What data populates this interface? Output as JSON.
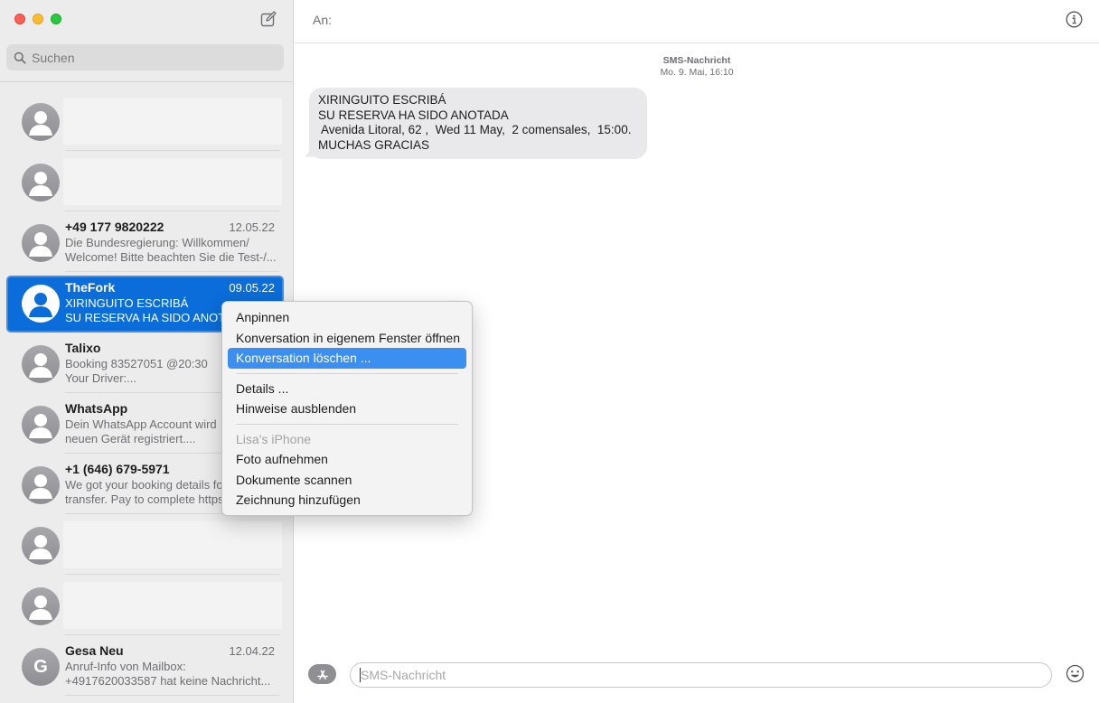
{
  "window": {
    "compose_icon": "compose-icon",
    "search": {
      "placeholder": "Suchen",
      "icon": "search-icon"
    }
  },
  "conversations": [
    {
      "name": "",
      "date": "",
      "preview": [
        "",
        ""
      ],
      "redacted": true
    },
    {
      "name": "",
      "date": "",
      "preview": [
        "",
        ""
      ],
      "redacted": true
    },
    {
      "name": "+49 177 9820222",
      "date": "12.05.22",
      "preview": [
        "Die Bundesregierung: Willkommen/",
        "Welcome! Bitte beachten Sie die Test-/..."
      ]
    },
    {
      "name": "TheFork",
      "date": "09.05.22",
      "preview": [
        "XIRINGUITO ESCRIBÁ",
        "SU RESERVA HA SIDO ANOTADA"
      ],
      "selected": true
    },
    {
      "name": "Talixo",
      "date": "",
      "preview": [
        "Booking 83527051 @20:30",
        "Your Driver:..."
      ]
    },
    {
      "name": "WhatsApp",
      "date": "",
      "preview": [
        "Dein WhatsApp Account wird",
        "neuen Gerät registriert...."
      ]
    },
    {
      "name": "+1 (646) 679-5971",
      "date": "",
      "preview": [
        "We got your booking details fo",
        "transfer. Pay to complete https"
      ]
    },
    {
      "name": "",
      "date": "",
      "preview": [
        "",
        ""
      ],
      "redacted": true
    },
    {
      "name": "",
      "date": "",
      "preview": [
        "",
        ""
      ],
      "redacted": true
    },
    {
      "name": "Gesa Neu",
      "date": "12.04.22",
      "preview": [
        "Anruf-Info von Mailbox:",
        "+4917620033587 hat keine Nachricht..."
      ],
      "initial": "G"
    }
  ],
  "header": {
    "to_label": "An:",
    "info_icon": "info-icon"
  },
  "message_meta": {
    "kind": "SMS-Nachricht",
    "timestamp": "Mo. 9. Mai, 16:10"
  },
  "message": {
    "lines": [
      "XIRINGUITO ESCRIBÁ",
      "SU RESERVA HA SIDO ANOTADA",
      " Avenida Litoral, 62 ,  Wed 11 May,  2 comensales,  15:00.",
      "MUCHAS GRACIAS"
    ]
  },
  "composer": {
    "placeholder": "SMS-Nachricht",
    "apps_icon": "app-store-icon",
    "emoji_icon": "emoji-icon"
  },
  "context_menu": {
    "groups": [
      [
        {
          "label": "Anpinnen"
        },
        {
          "label": "Konversation in eigenem Fenster öffnen"
        },
        {
          "label": "Konversation löschen ...",
          "highlighted": true
        }
      ],
      [
        {
          "label": "Details ..."
        },
        {
          "label": "Hinweise ausblenden"
        }
      ],
      [
        {
          "label": "Lisa’s iPhone",
          "disabled": true
        },
        {
          "label": "Foto aufnehmen"
        },
        {
          "label": "Dokumente scannen"
        },
        {
          "label": "Zeichnung hinzufügen"
        }
      ]
    ]
  },
  "colors": {
    "selection": "#0a6dd9",
    "menu_highlight": "#3b8ff0",
    "bubble": "#e9e9eb"
  }
}
